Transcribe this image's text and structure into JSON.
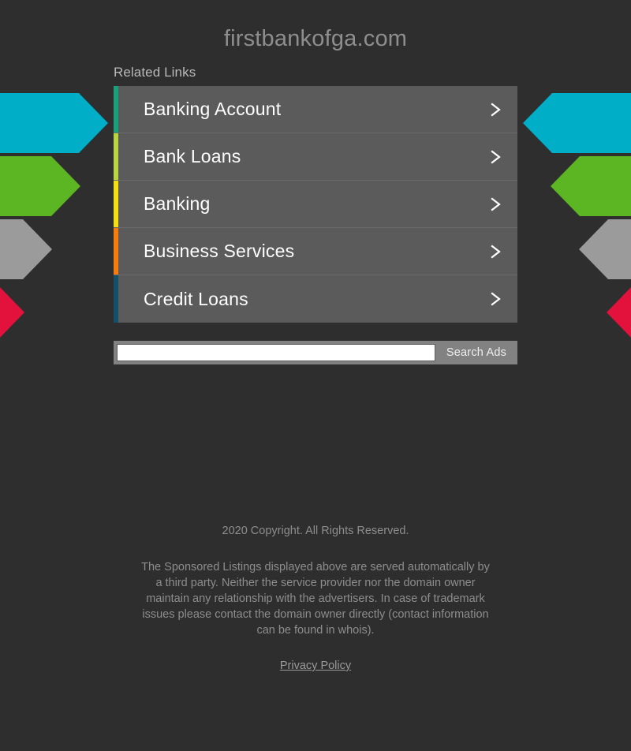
{
  "page": {
    "background_color": "#2e2e2e",
    "domain_title": "firstbankofga.com"
  },
  "related_links": {
    "heading": "Related Links",
    "items": [
      {
        "label": "Banking Account",
        "accent_color": "#18a07a",
        "chevron": "chevron-right-icon"
      },
      {
        "label": "Bank Loans",
        "accent_color": "#b9d341",
        "chevron": "chevron-right-icon"
      },
      {
        "label": "Banking",
        "accent_color": "#f2e014",
        "chevron": "chevron-right-icon"
      },
      {
        "label": "Business Services",
        "accent_color": "#f57d0d",
        "chevron": "chevron-right-icon"
      },
      {
        "label": "Credit Loans",
        "accent_color": "#14506b",
        "chevron": "chevron-right-icon"
      }
    ]
  },
  "search": {
    "value": "",
    "placeholder": "",
    "button_label": "Search Ads"
  },
  "decorations": {
    "left_arrows": [
      {
        "color": "#00aec7",
        "name": "decorative-arrow-cyan-left"
      },
      {
        "color": "#5cb522",
        "name": "decorative-arrow-green-left"
      },
      {
        "color": "#9b9b9b",
        "name": "decorative-arrow-gray-left"
      },
      {
        "color": "#e3123c",
        "name": "decorative-arrow-red-left"
      }
    ],
    "right_arrows": [
      {
        "color": "#00aec7",
        "name": "decorative-arrow-cyan-right"
      },
      {
        "color": "#5cb522",
        "name": "decorative-arrow-green-right"
      },
      {
        "color": "#9b9b9b",
        "name": "decorative-arrow-gray-right"
      },
      {
        "color": "#e3123c",
        "name": "decorative-arrow-red-right"
      }
    ]
  },
  "footer": {
    "copyright": "2020 Copyright. All Rights Reserved.",
    "disclaimer": "The Sponsored Listings displayed above are served automatically by a third party. Neither the service provider nor the domain owner maintain any relationship with the advertisers. In case of trademark issues please contact the domain owner directly (contact information can be found in whois).",
    "privacy_label": "Privacy Policy"
  }
}
